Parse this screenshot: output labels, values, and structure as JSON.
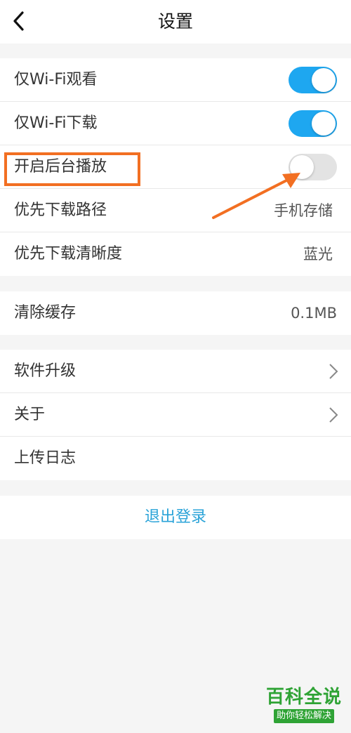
{
  "header": {
    "title": "设置",
    "back_icon": "chevron-left-icon"
  },
  "playback_section": {
    "rows": [
      {
        "label": "仅Wi-Fi观看",
        "control": "toggle",
        "enabled": true
      },
      {
        "label": "仅Wi-Fi下载",
        "control": "toggle",
        "enabled": true
      },
      {
        "label": "开启后台播放",
        "control": "toggle",
        "enabled": false
      },
      {
        "label": "优先下载路径",
        "value": "手机存储"
      },
      {
        "label": "优先下载清晰度",
        "value": "蓝光"
      }
    ]
  },
  "cache_section": {
    "label": "清除缓存",
    "value": "0.1MB"
  },
  "about_section": {
    "rows": [
      {
        "label": "软件升级",
        "icon": "chevron-right-icon"
      },
      {
        "label": "关于",
        "icon": "chevron-right-icon"
      },
      {
        "label": "上传日志"
      }
    ]
  },
  "logout": {
    "label": "退出登录"
  },
  "colors": {
    "toggle_on": "#1ea7f0",
    "toggle_off": "#e3e3e3",
    "link": "#2aa3d8",
    "annotation": "#f26f22",
    "watermark": "#2fa335"
  },
  "annotation": {
    "highlight_target": "开启后台播放",
    "arrow_icon": "arrow-icon"
  },
  "watermark": {
    "title": "百科全说",
    "subtitle": "助你轻松解决"
  }
}
